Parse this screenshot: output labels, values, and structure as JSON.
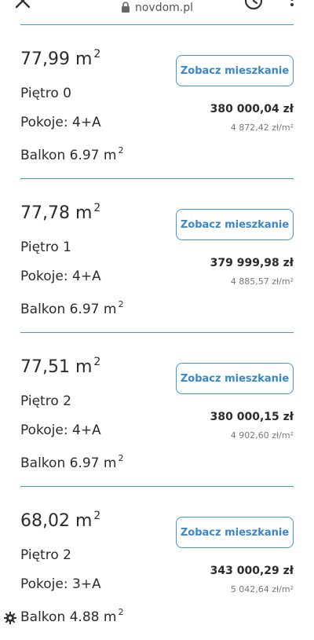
{
  "browser": {
    "url": "novdom.pl",
    "close_icon": "close-icon",
    "lock_icon": "lock-icon",
    "history_icon": "history-icon",
    "menu_icon": "more-vert-icon"
  },
  "listings": [
    {
      "area": "77,99 m",
      "area_sup": "2",
      "floor": "Piętro 0",
      "rooms": "Pokoje: 4+A",
      "balcony": "Balkon 6.97 m",
      "balcony_sup": "2",
      "button_label": "Zobacz mieszkanie",
      "price": "380 000,04 zł",
      "price_per_m2": "4 872,42 zł/m²"
    },
    {
      "area": "77,78 m",
      "area_sup": "2",
      "floor": "Piętro 1",
      "rooms": "Pokoje: 4+A",
      "balcony": "Balkon 6.97 m",
      "balcony_sup": "2",
      "button_label": "Zobacz mieszkanie",
      "price": "379 999,98 zł",
      "price_per_m2": "4 885,57 zł/m²"
    },
    {
      "area": "77,51 m",
      "area_sup": "2",
      "floor": "Piętro 2",
      "rooms": "Pokoje: 4+A",
      "balcony": "Balkon 6.97 m",
      "balcony_sup": "2",
      "button_label": "Zobacz mieszkanie",
      "price": "380 000,15 zł",
      "price_per_m2": "4 902,60 zł/m²"
    },
    {
      "area": "68,02 m",
      "area_sup": "2",
      "floor": "Piętro 2",
      "rooms": "Pokoje: 3+A",
      "balcony": "Balkon 4.88 m",
      "balcony_sup": "2",
      "button_label": "Zobacz mieszkanie",
      "price": "343 000,29 zł",
      "price_per_m2": "5 042,64 zł/m²"
    }
  ],
  "colors": {
    "accent": "#3b9ad9",
    "button_text": "#3b86c9",
    "text": "#2b2b2b",
    "muted": "#777777"
  },
  "floating_icon": "gear-icon"
}
